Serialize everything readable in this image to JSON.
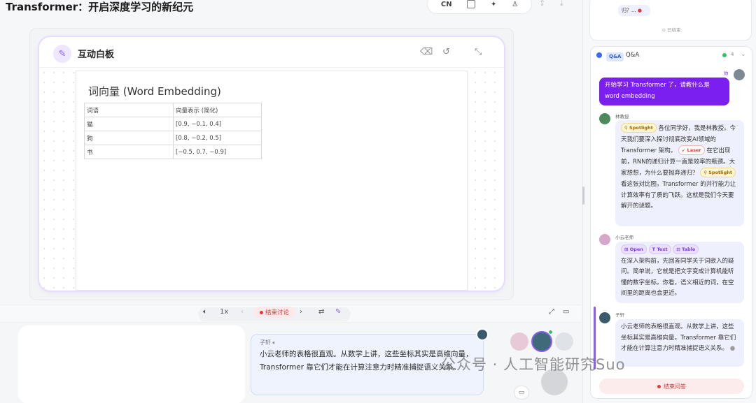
{
  "header": {
    "title": "Transformer：开启深度学习的新纪元",
    "lang": "CN"
  },
  "whiteboard": {
    "panel_title": "互动白板",
    "doc_title": "词向量 (Word Embedding)",
    "table_headers": [
      "词语",
      "向量表示 (简化)"
    ],
    "table_rows": [
      [
        "猫",
        "[0.9, −0.1, 0.4]"
      ],
      [
        "狗",
        "[0.8, −0.2, 0.5]"
      ],
      [
        "书",
        "[−0.5, 0.7, −0.9]"
      ]
    ]
  },
  "controls": {
    "speed": "1x",
    "end_discussion": "结束讨论"
  },
  "chat": {
    "speaker": "子轩",
    "text": "小云老师的表格很直观。从数学上讲，这些坐标其实是高维向量，Transformer 靠它们才能在计算注意力时精准捕捉语义关系。"
  },
  "watermark": "公众号 · 人工智能研究Suo",
  "right_panel": {
    "prev_snippet": "归？... ",
    "prev_status": "已结束",
    "qa_badge": "Q&A",
    "qa_title": "Q&A",
    "qa_count": "4",
    "you_label": "你",
    "user_question": "开始学习 Transformer 了，请教什么是 word embedding",
    "prof_name": "林教授",
    "prof_part1": "各位同学好，我是林教授。今天我们要深入探讨彻底改变AI领域的 Transformer 架构。",
    "prof_part2": "在它出现前，RNN的递归计算一直是效率的瓶颈。大家想想，为什么要抛弃递归？",
    "prof_part3": "看这张对比图，Transformer 的并行能力让计算效率有了质的飞跃。这就是我们今天要解开的谜题。",
    "chip_spotlight": "Spotlight",
    "chip_laser": "Laser",
    "teacher_name": "小云老师",
    "chip_open": "Open",
    "chip_text": "Text",
    "chip_table": "Table",
    "teacher_text": "在深入架构前，先回答同学关于词嵌入的疑问。简单说，它就是把文字变成计算机能听懂的数字坐标。你看，语义相近的词，在空间里的距离也会更近。",
    "student_name": "子轩",
    "student_text": "小云老师的表格很直观。从数学上讲，这些坐标其实是高维向量，Transformer 靠它们才能在计算注意力时精准捕捉语义关系。",
    "end_qa": "结束问答"
  },
  "colors": {
    "accent": "#7b1ff0",
    "danger": "#e23b3b",
    "qa_bubble": "#eef1fd"
  }
}
